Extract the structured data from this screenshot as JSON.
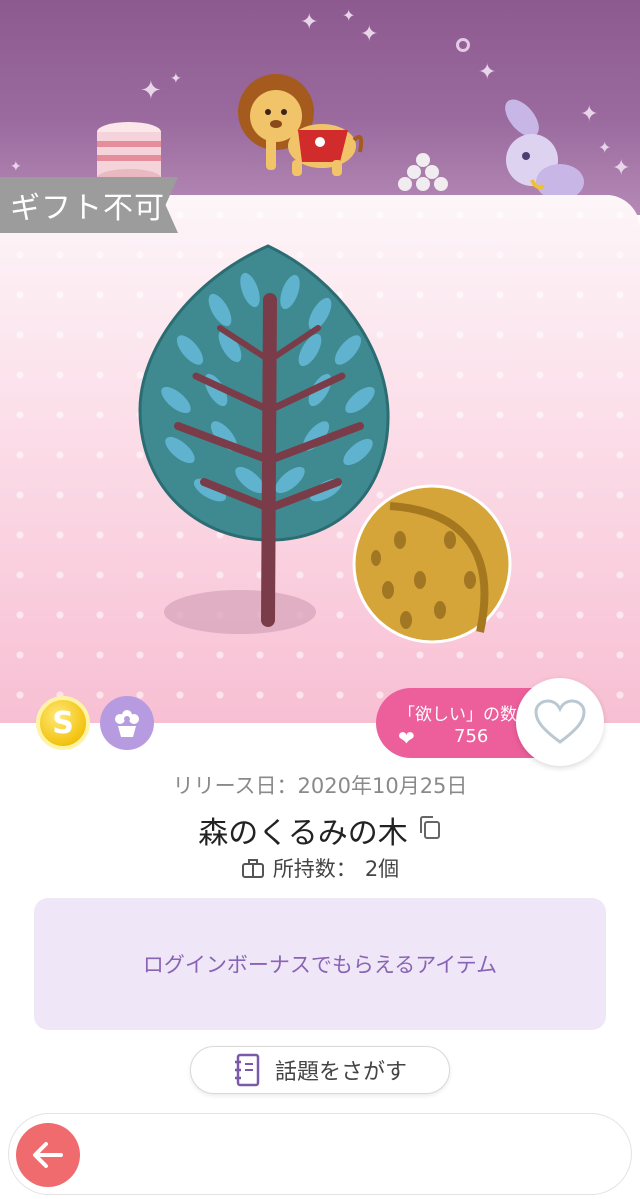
{
  "banner": {
    "decor": [
      "lion-icon",
      "drum-icon",
      "rabbit-icon",
      "sparkle-icon"
    ]
  },
  "item": {
    "gift_status": "ギフト不可",
    "release_label": "リリース日：",
    "release_date": "2020年10月25日",
    "name": "森のくるみの木",
    "owned_label": "所持数：",
    "owned_count": "2個"
  },
  "badges": {
    "coin_letter": "S",
    "coin_icon": "coin-icon",
    "flower_icon": "flower-pot-icon"
  },
  "wishlist": {
    "label": "「欲しい」の数",
    "count": "756"
  },
  "info": {
    "message": "ログインボーナスでもらえるアイテム"
  },
  "actions": {
    "topic_button": "話題をさがす"
  },
  "colors": {
    "accent_pink": "#ec5f9b",
    "back_red": "#ef6b6e",
    "info_purple": "#8a64b4"
  }
}
